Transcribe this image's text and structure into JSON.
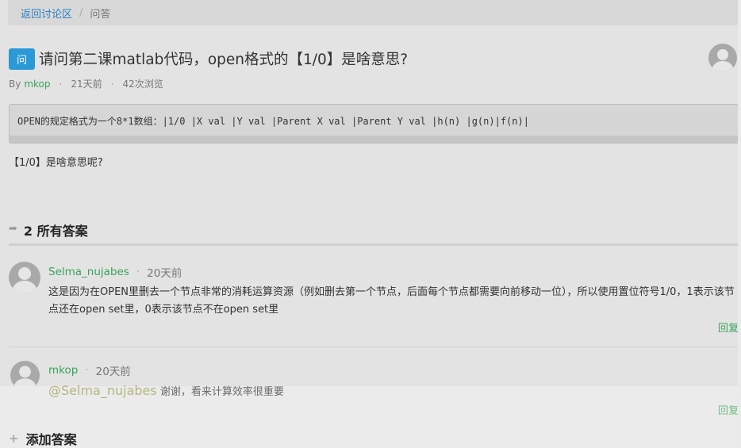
{
  "breadcrumb": {
    "back_label": "返回讨论区",
    "separator": "/",
    "current": "问答"
  },
  "question": {
    "badge": "问",
    "title": "请问第二课matlab代码，open格式的【1/0】是啥意思?",
    "by_label": "By",
    "author": "mkop",
    "time": "21天前",
    "views": "42次浏览",
    "code": "OPEN的规定格式为一个8*1数组：|1/0 |X val |Y val |Parent X val |Parent Y val |h(n) |g(n)|f(n)|",
    "text": "【1/0】是啥意思呢?"
  },
  "answers_section": {
    "icon": "share-arrow-icon",
    "heading": "2 所有答案"
  },
  "answers": [
    {
      "author": "Selma_nujabes",
      "time": "20天前",
      "body": "这是因为在OPEN里删去一个节点非常的消耗运算资源（例如删去第一个节点，后面每个节点都需要向前移动一位），所以使用置位符号1/0，1表示该节点还在open set里，0表示该节点不在open set里",
      "reply_label": "回复"
    },
    {
      "author": "mkop",
      "time": "20天前",
      "mention": "@Selma_nujabes",
      "body": "谢谢，看来计算效率很重要",
      "reply_label": "回复"
    }
  ],
  "add_answer": {
    "icon": "plus-icon",
    "label": "添加答案"
  },
  "colors": {
    "link_blue": "#2a7fc6",
    "author_green": "#3aa35a",
    "badge_blue": "#2a99d6"
  }
}
